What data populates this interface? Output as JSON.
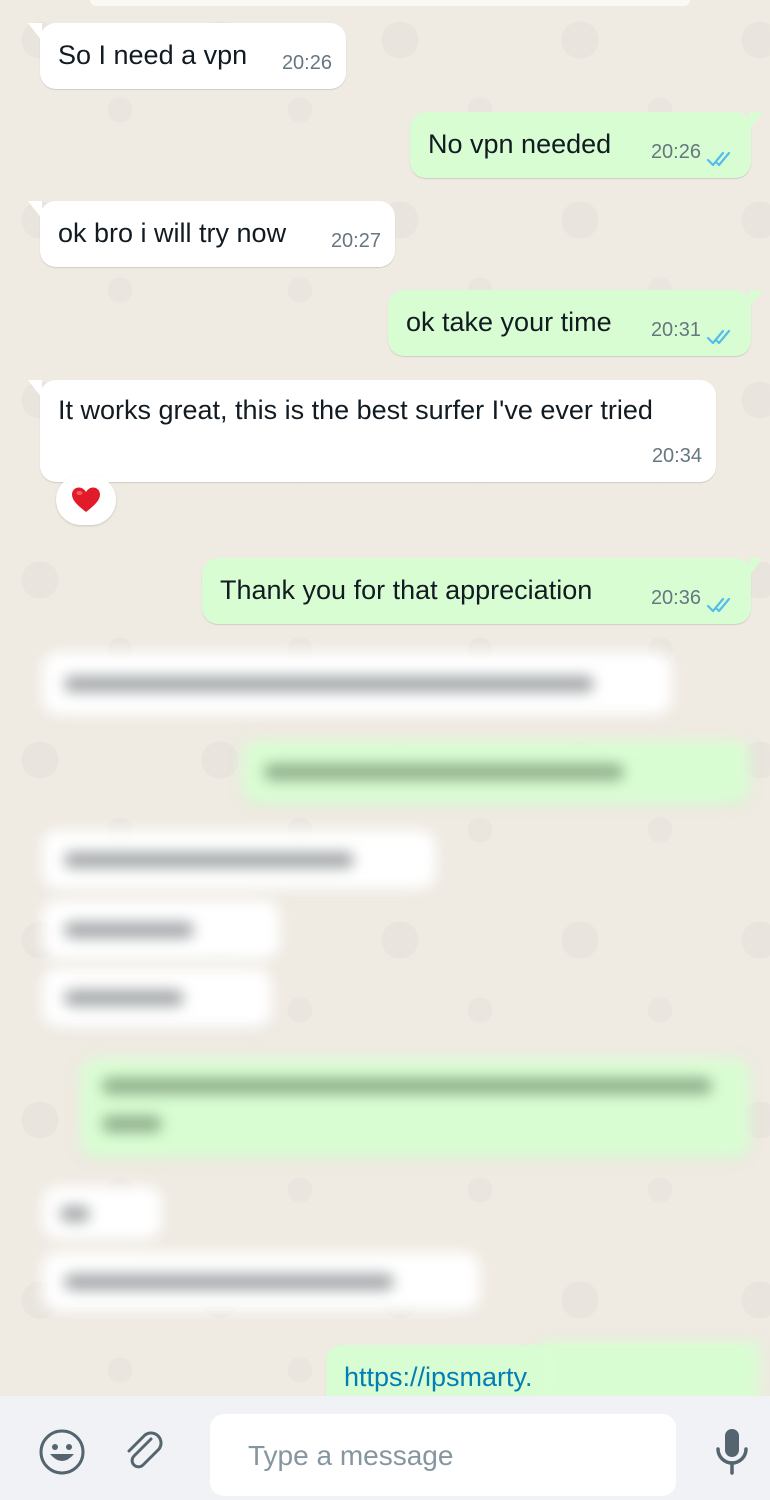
{
  "messages": [
    {
      "direction": "incoming",
      "text": "So I need a vpn",
      "time": "20:26"
    },
    {
      "direction": "outgoing",
      "text": "No vpn needed",
      "time": "20:26",
      "status": "read-double-check-icon"
    },
    {
      "direction": "incoming",
      "text": "ok bro i will try now",
      "time": "20:27"
    },
    {
      "direction": "outgoing",
      "text": "ok take your time",
      "time": "20:31",
      "status": "read-double-check-icon"
    },
    {
      "direction": "incoming",
      "text": "It works great, this is the best surfer I've ever tried",
      "time": "20:34",
      "reaction": "heart-emoji"
    },
    {
      "direction": "outgoing",
      "text": "Thank you for that appreciation",
      "time": "20:36",
      "status": "read-double-check-icon"
    },
    {
      "direction": "outgoing",
      "text": "https://ipsmarty.",
      "type": "link",
      "partially_blurred": true
    }
  ],
  "composer": {
    "placeholder": "Type a message",
    "emoji_icon": "emoji-icon",
    "attach_icon": "paperclip-icon",
    "mic_icon": "microphone-icon"
  },
  "colors": {
    "chat_background": "#efeae2",
    "incoming_bubble": "#ffffff",
    "outgoing_bubble": "#d9fdd3",
    "read_ticks": "#53bdeb",
    "link": "#027eb5",
    "timestamp": "#667781"
  }
}
